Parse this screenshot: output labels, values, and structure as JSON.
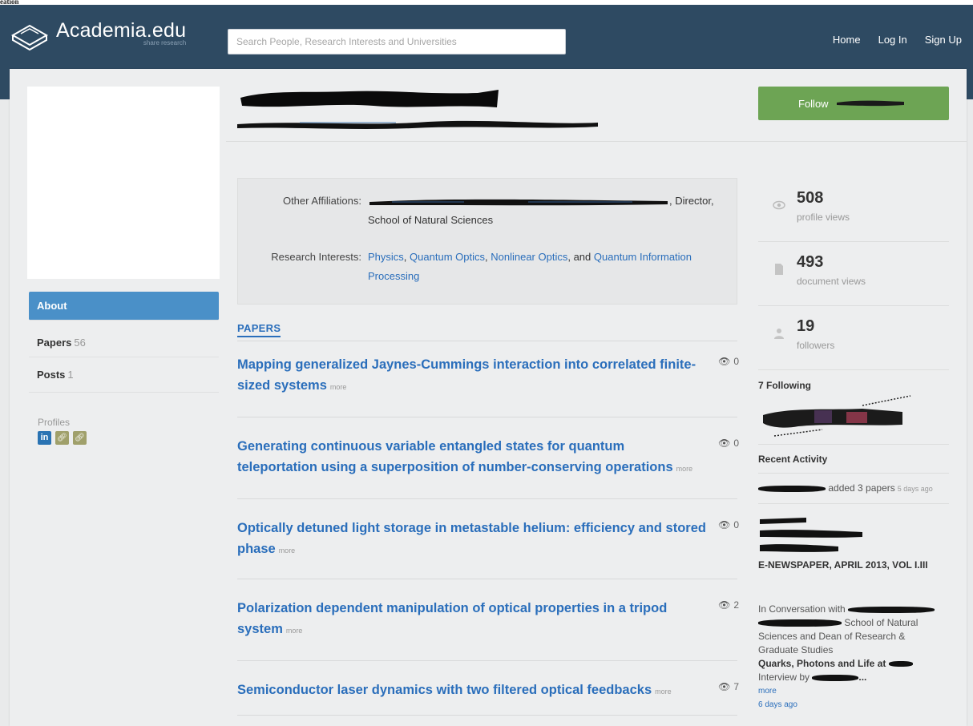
{
  "top_strip_label": "eation",
  "header": {
    "logo_title": "Academia.edu",
    "logo_tagline": "share research",
    "search_placeholder": "Search People, Research Interests and Universities",
    "nav": [
      "Home",
      "Log In",
      "Sign Up"
    ]
  },
  "follow_button_label": "Follow",
  "sidebar": {
    "items": [
      {
        "label": "About",
        "count": ""
      },
      {
        "label": "Papers",
        "count": "56"
      },
      {
        "label": "Posts",
        "count": "1"
      }
    ],
    "profiles_label": "Profiles",
    "profile_icons": [
      "linkedin-icon",
      "link-icon",
      "link-icon"
    ]
  },
  "affiliations": {
    "other_label": "Other Affiliations:",
    "other_value_tail": ", Director,",
    "other_value_line2": "School of Natural Sciences",
    "interests_label": "Research Interests:",
    "interests": [
      "Physics",
      "Quantum Optics",
      "Nonlinear Optics",
      "Quantum Information Processing"
    ],
    "sep_comma": ",",
    "sep_and": ", and"
  },
  "papers": {
    "heading": "PAPERS",
    "more_label": "more",
    "list": [
      {
        "title": "Mapping generalized Jaynes-Cummings interaction into correlated finite-sized systems",
        "views": "0"
      },
      {
        "title": "Generating continuous variable entangled states for quantum teleportation using a superposition of number-conserving operations",
        "views": "0"
      },
      {
        "title": "Optically detuned light storage in metastable helium: efficiency and stored phase",
        "views": "0"
      },
      {
        "title": "Polarization dependent manipulation of optical properties in a tripod system",
        "views": "2"
      },
      {
        "title": "Semiconductor laser dynamics with two filtered optical feedbacks",
        "views": "7"
      }
    ]
  },
  "stats": [
    {
      "number": "508",
      "label": "profile views",
      "icon": "eye-icon"
    },
    {
      "number": "493",
      "label": "document views",
      "icon": "document-icon"
    },
    {
      "number": "19",
      "label": "followers",
      "icon": "person-icon"
    }
  ],
  "following_label": "7 Following",
  "recent_activity": {
    "heading": "Recent Activity",
    "added_text": "added 3 papers",
    "added_ago": "5 days ago",
    "enewspaper": "E-NEWSPAPER, APRIL 2013, VOL I.III",
    "conv_prefix": "In Conversation with",
    "conv_mid": "School of Natural Sciences and Dean of Research & Graduate Studies",
    "conv_bold": "Quarks, Photons and Life at",
    "conv_interview": "Interview by",
    "conv_ellipsis": "...",
    "more_label": "more",
    "conv_ago": "6 days ago"
  }
}
